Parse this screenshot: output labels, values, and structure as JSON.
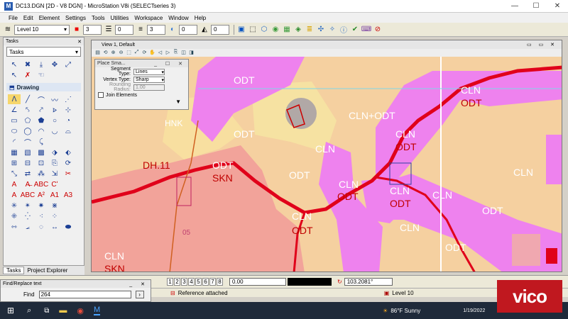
{
  "window": {
    "title": "DC13.DGN [2D - V8 DGN] - MicroStation V8i (SELECTseries 3)"
  },
  "menu": [
    "File",
    "Edit",
    "Element",
    "Settings",
    "Tools",
    "Utilities",
    "Workspace",
    "Window",
    "Help"
  ],
  "toolbar": {
    "level": "Level 10",
    "color": "3",
    "weight": "3",
    "style1": "0",
    "style2": "0",
    "style3": "0"
  },
  "tasks": {
    "panel_title": "Tasks",
    "dropdown": "Tasks",
    "section": "Drawing",
    "tabs": [
      "Tasks",
      "Project Explorer"
    ]
  },
  "view": {
    "title": "View 1, Default"
  },
  "place_smart_line": {
    "title": "Place Sma...",
    "segment_type_label": "Segment Type:",
    "segment_type": "Lines",
    "vertex_type_label": "Vertex Type:",
    "vertex_type": "Sharp",
    "rounding_label": "Rounding Radius:",
    "rounding": "1.00",
    "join_label": "Join Elements"
  },
  "map_labels": [
    {
      "t": "ODT",
      "red": false
    },
    {
      "t": "CLN",
      "red": false
    },
    {
      "t": "ODT",
      "red": true
    },
    {
      "t": "CLN+ODT",
      "red": false
    },
    {
      "t": "ODT",
      "red": false
    },
    {
      "t": "CLN",
      "red": false
    },
    {
      "t": "ODT",
      "red": true
    },
    {
      "t": "HNK",
      "red": false
    },
    {
      "t": "DH.11",
      "red": true
    },
    {
      "t": "ODT",
      "red": false
    },
    {
      "t": "SKN",
      "red": true
    },
    {
      "t": "ODT",
      "red": false
    },
    {
      "t": "CLN",
      "red": false
    },
    {
      "t": "ODT",
      "red": true
    },
    {
      "t": "CLN",
      "red": false
    },
    {
      "t": "CLN",
      "red": false
    },
    {
      "t": "ODT",
      "red": true
    },
    {
      "t": "CLN",
      "red": false
    },
    {
      "t": "ODT",
      "red": true
    },
    {
      "t": "ODT",
      "red": false
    },
    {
      "t": "CLN",
      "red": false
    },
    {
      "t": "CLN",
      "red": false
    },
    {
      "t": "ODT",
      "red": false
    },
    {
      "t": "CLN",
      "red": false
    },
    {
      "t": "SKN",
      "red": true
    },
    {
      "t": "05",
      "red": false
    },
    {
      "t": "CLN",
      "red": false
    }
  ],
  "status": {
    "views": [
      "1",
      "2",
      "3",
      "4",
      "5",
      "6",
      "7",
      "8"
    ],
    "coord": "0.00",
    "value": "103.2081°",
    "reference": "Reference attached",
    "level": "Level 10"
  },
  "find": {
    "title": "Find/Replace text",
    "label": "Find",
    "value": "264"
  },
  "taskbar": {
    "weather": "86°F  Sunny",
    "date": "1/19/2022"
  },
  "watermark": "vico"
}
